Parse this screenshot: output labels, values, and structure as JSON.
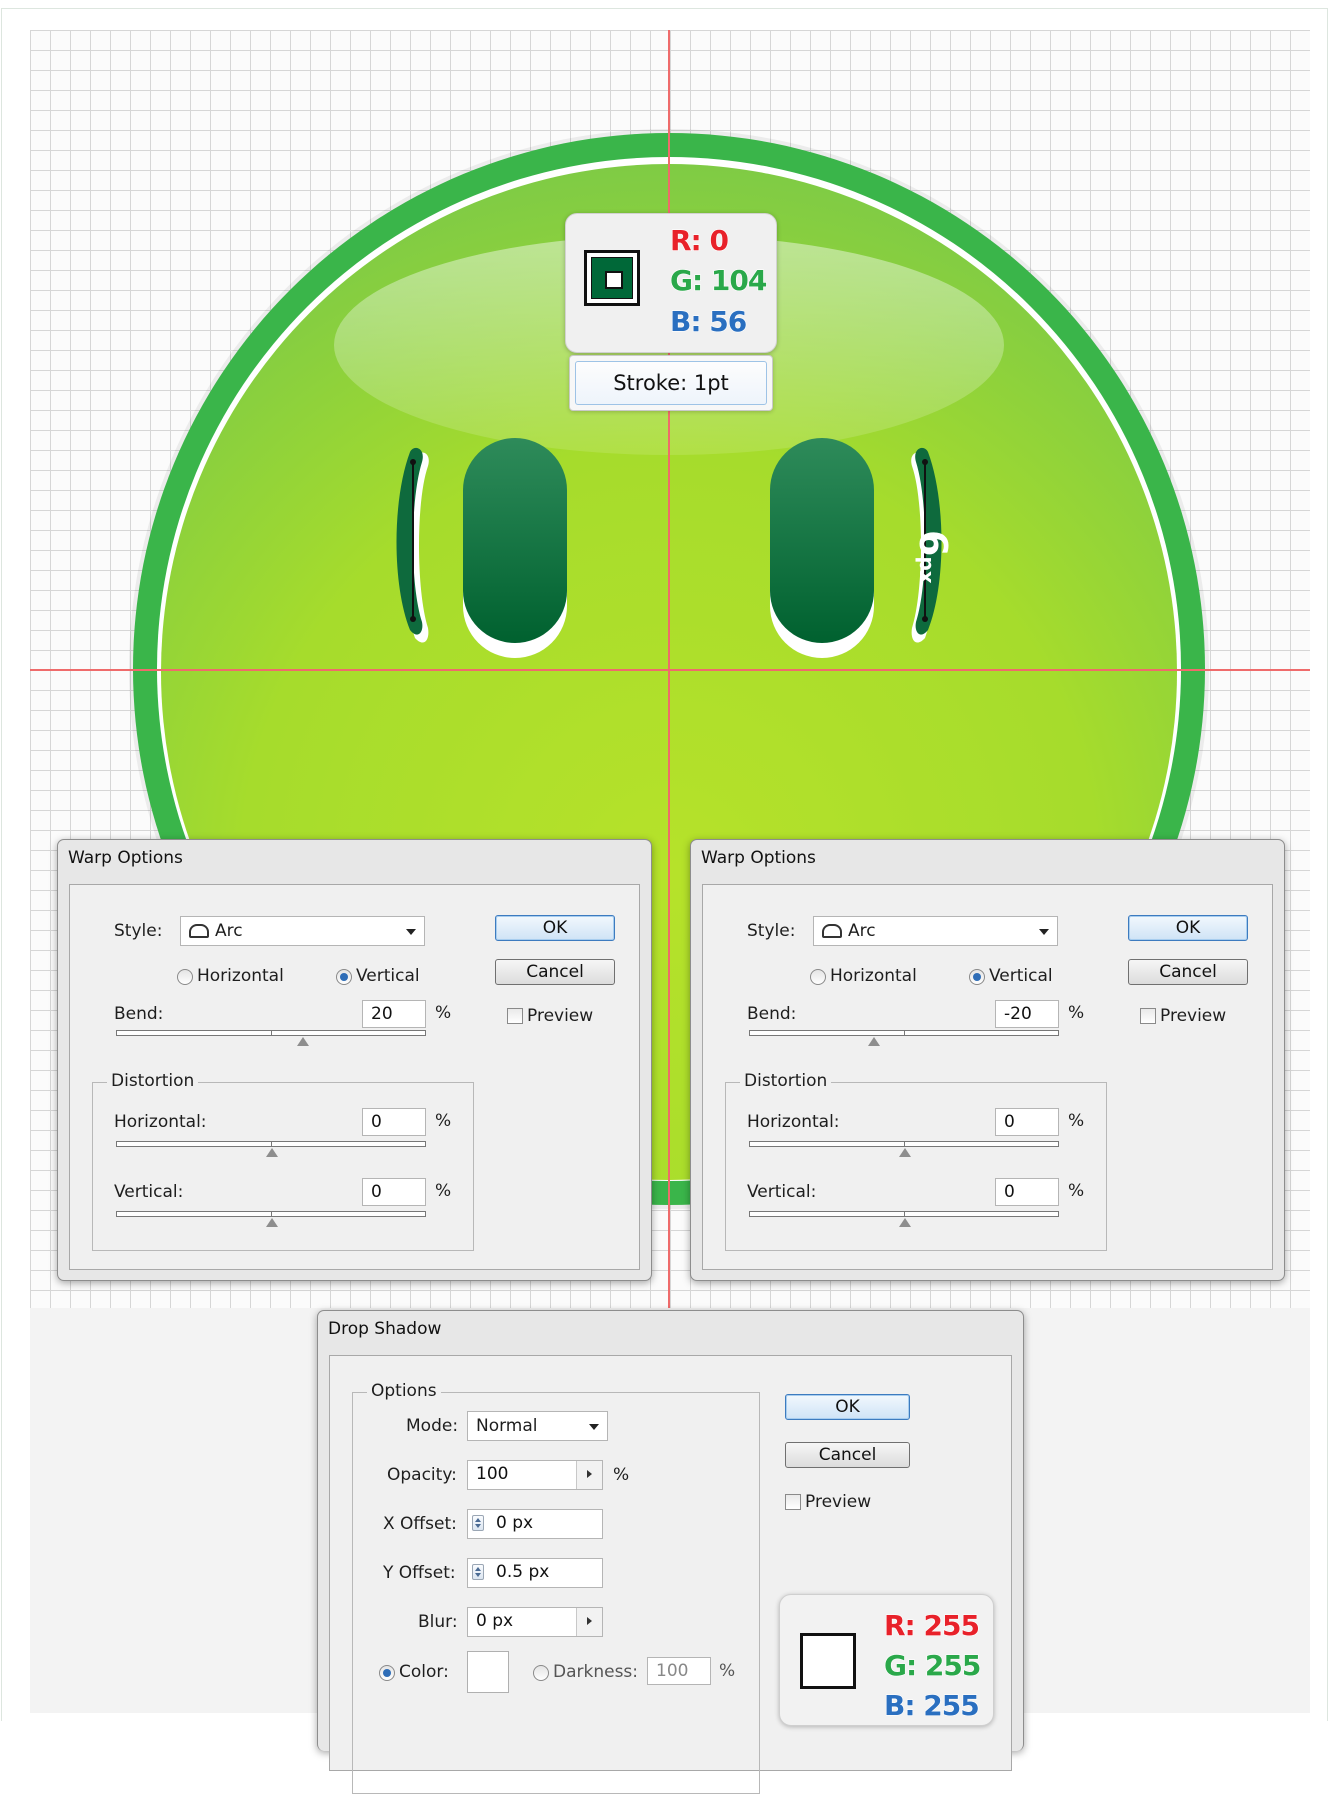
{
  "stroke_color": {
    "r_label": "R: 0",
    "g_label": "G: 104",
    "b_label": "B: 56",
    "hex": "#006838"
  },
  "stroke_tooltip": "Stroke: 1pt",
  "px_annotation": {
    "number": "6",
    "unit": "px"
  },
  "colors": {
    "face_outer": "#3ab54a",
    "face_inner_top": "#8ed04a",
    "face_inner_bottom": "#b0e02a",
    "eye": "#0b6a3d",
    "guide": "#ef6b6b"
  },
  "warp_left": {
    "title": "Warp Options",
    "style_label": "Style:",
    "style_value": "Arc",
    "style_icon": "arc-warp-icon",
    "horizontal_label": "Horizontal",
    "vertical_label": "Vertical",
    "orientation_selected": "Vertical",
    "bend_label": "Bend:",
    "bend_value": "20",
    "percent": "%",
    "bend_slider": 0.6,
    "distortion_title": "Distortion",
    "dist_h_label": "Horizontal:",
    "dist_h_value": "0",
    "dist_v_label": "Vertical:",
    "dist_v_value": "0",
    "ok": "OK",
    "cancel": "Cancel",
    "preview": "Preview"
  },
  "warp_right": {
    "title": "Warp Options",
    "style_label": "Style:",
    "style_value": "Arc",
    "style_icon": "arc-warp-icon",
    "horizontal_label": "Horizontal",
    "vertical_label": "Vertical",
    "orientation_selected": "Vertical",
    "bend_label": "Bend:",
    "bend_value": "-20",
    "percent": "%",
    "bend_slider": 0.4,
    "distortion_title": "Distortion",
    "dist_h_label": "Horizontal:",
    "dist_h_value": "0",
    "dist_v_label": "Vertical:",
    "dist_v_value": "0",
    "ok": "OK",
    "cancel": "Cancel",
    "preview": "Preview"
  },
  "drop_shadow": {
    "title": "Drop Shadow",
    "options_title": "Options",
    "mode_label": "Mode:",
    "mode_value": "Normal",
    "opacity_label": "Opacity:",
    "opacity_value": "100",
    "percent": "%",
    "x_offset_label": "X Offset:",
    "x_offset_value": "0 px",
    "y_offset_label": "Y Offset:",
    "y_offset_value": "0.5 px",
    "blur_label": "Blur:",
    "blur_value": "0 px",
    "color_label": "Color:",
    "darkness_label": "Darkness:",
    "darkness_value": "100",
    "ok": "OK",
    "cancel": "Cancel",
    "preview": "Preview"
  },
  "shadow_color": {
    "r_label": "R: 255",
    "g_label": "G: 255",
    "b_label": "B: 255",
    "hex": "#ffffff"
  }
}
